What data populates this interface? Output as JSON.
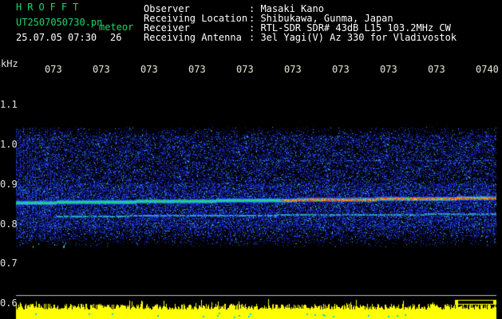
{
  "header": {
    "app_title": "HROFFT",
    "filename": "UT2507050730.pn",
    "mode": "meteor",
    "datetime": "25.07.05 07:30",
    "count": "26",
    "info_labels": [
      "Observer",
      "Receiving Location",
      "Receiver",
      "Receiving Antenna"
    ],
    "info_values": [
      ": Masaki Kano",
      ": Shibukawa, Gunma, Japan",
      ": RTL-SDR SDR# 43dB L15 103.2MHz CW",
      ": 3el Yagi(V) Az 330 for Vladivostok"
    ]
  },
  "axis": {
    "unit": "kHz",
    "y_ticks": [
      "1.1",
      "1.0",
      "0.9",
      "0.8",
      "0.7",
      "0.6"
    ],
    "x_ticks": [
      "073",
      "073",
      "073",
      "073",
      "073",
      "073",
      "073",
      "073",
      "073",
      "0740"
    ]
  },
  "colors": {
    "background": "#000000",
    "title_green": "#19d86a",
    "noise_blue": "#1a2bd0",
    "signal_red": "#ff2020",
    "meter_yellow": "#ffff00",
    "tick_text": "#e8e8d0"
  }
}
